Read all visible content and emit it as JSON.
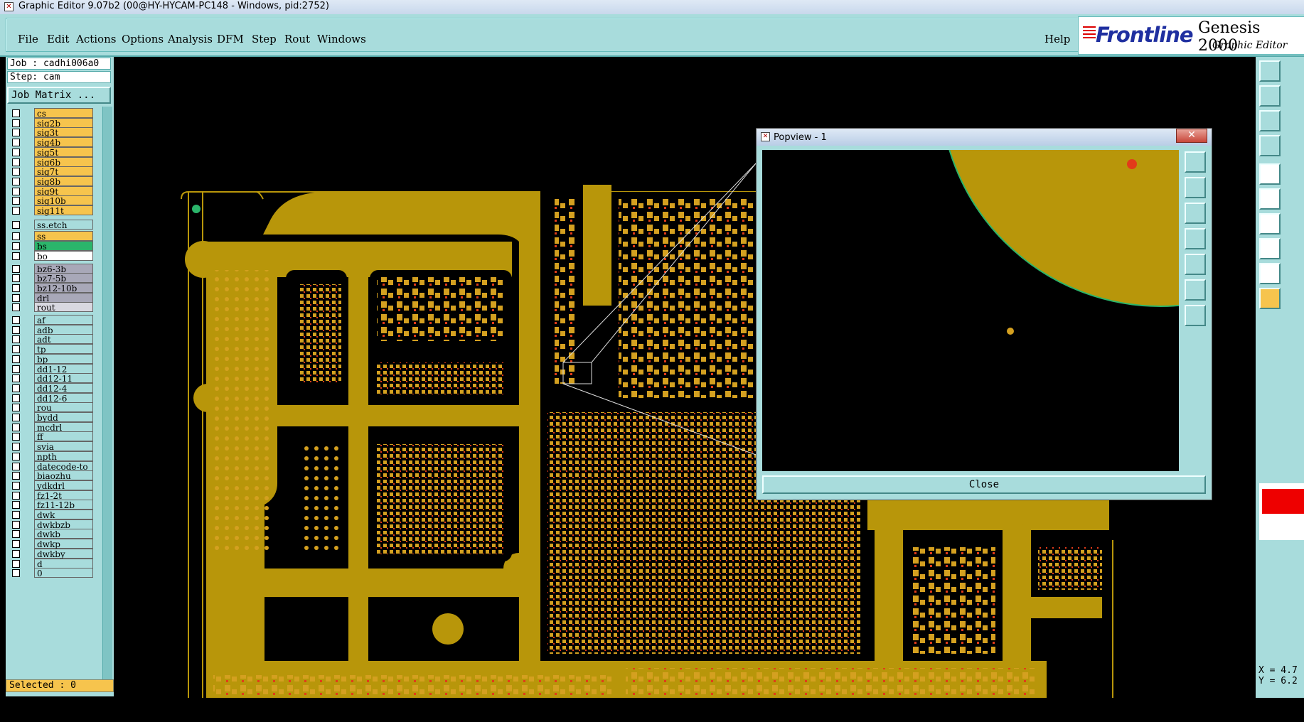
{
  "window": {
    "title": "Graphic Editor 9.07b2 (00@HY-HYCAM-PC148 - Windows, pid:2752)"
  },
  "menu": {
    "file": "File",
    "edit": "Edit",
    "actions": "Actions",
    "options": "Options",
    "analysis": "Analysis",
    "dfm": "DFM",
    "step": "Step",
    "rout": "Rout",
    "windows": "Windows",
    "help": "Help"
  },
  "logo": {
    "brand": "Frontline",
    "product": "Genesis 2000",
    "subtitle": "Graphic Editor"
  },
  "job": {
    "job_label": "Job : cadhi006a0",
    "step_label": "Step: cam",
    "matrix_button": "Job Matrix ..."
  },
  "layers": [
    {
      "name": "cs",
      "color": "#f6c44d"
    },
    {
      "name": "sig2b",
      "color": "#f6c44d"
    },
    {
      "name": "sig3t",
      "color": "#f6c44d"
    },
    {
      "name": "sig4b",
      "color": "#f6c44d"
    },
    {
      "name": "sig5t",
      "color": "#f6c44d"
    },
    {
      "name": "sig6b",
      "color": "#f6c44d"
    },
    {
      "name": "sig7t",
      "color": "#f6c44d"
    },
    {
      "name": "sig8b",
      "color": "#f6c44d"
    },
    {
      "name": "sig9t",
      "color": "#f6c44d"
    },
    {
      "name": "sig10b",
      "color": "#f6c44d"
    },
    {
      "name": "sig11t",
      "color": "#f6c44d"
    },
    {
      "name": "ss.etch",
      "color": "#a8dcdc"
    },
    {
      "name": "ss",
      "color": "#f6c44d"
    },
    {
      "name": "bs",
      "color": "#2bb56b"
    },
    {
      "name": "bo",
      "color": "#ffffff"
    },
    {
      "name": "bz6-3b",
      "color": "#a8a8b8"
    },
    {
      "name": "bz7-5b",
      "color": "#a8a8b8"
    },
    {
      "name": "bz12-10b",
      "color": "#a8a8b8"
    },
    {
      "name": "drl",
      "color": "#a8a8b8"
    },
    {
      "name": "rout",
      "color": "#d8d8e0"
    },
    {
      "name": "af",
      "color": "#a8dcdc"
    },
    {
      "name": "adb",
      "color": "#a8dcdc"
    },
    {
      "name": "adt",
      "color": "#a8dcdc"
    },
    {
      "name": "tp",
      "color": "#a8dcdc"
    },
    {
      "name": "bp",
      "color": "#a8dcdc"
    },
    {
      "name": "dd1-12",
      "color": "#a8dcdc"
    },
    {
      "name": "dd12-11",
      "color": "#a8dcdc"
    },
    {
      "name": "dd12-4",
      "color": "#a8dcdc"
    },
    {
      "name": "dd12-6",
      "color": "#a8dcdc"
    },
    {
      "name": "rou",
      "color": "#a8dcdc"
    },
    {
      "name": "bydd",
      "color": "#a8dcdc"
    },
    {
      "name": "mcdrl",
      "color": "#a8dcdc"
    },
    {
      "name": "ff",
      "color": "#a8dcdc"
    },
    {
      "name": "svia",
      "color": "#a8dcdc"
    },
    {
      "name": "npth",
      "color": "#a8dcdc"
    },
    {
      "name": "datecode-to",
      "color": "#a8dcdc"
    },
    {
      "name": "biaozhu",
      "color": "#a8dcdc"
    },
    {
      "name": "ydkdrl",
      "color": "#a8dcdc"
    },
    {
      "name": "fz1-2t",
      "color": "#a8dcdc"
    },
    {
      "name": "fz11-12b",
      "color": "#a8dcdc"
    },
    {
      "name": "dwk",
      "color": "#a8dcdc"
    },
    {
      "name": "dwkbzb",
      "color": "#a8dcdc"
    },
    {
      "name": "dwkb",
      "color": "#a8dcdc"
    },
    {
      "name": "dwkp",
      "color": "#a8dcdc"
    },
    {
      "name": "dwkby",
      "color": "#a8dcdc"
    },
    {
      "name": "d",
      "color": "#a8dcdc"
    },
    {
      "name": "0",
      "color": "#a8dcdc"
    }
  ],
  "status": {
    "selected": "Selected : 0"
  },
  "coords": {
    "x": "X = 4.7",
    "y": "Y = 6.2"
  },
  "popview": {
    "title": "Popview - 1",
    "close_button": "Close"
  },
  "colors": {
    "panel": "#a8dcdc",
    "copper": "#b8960a",
    "pad": "#d4a020",
    "accent_red": "#e23b1a"
  }
}
